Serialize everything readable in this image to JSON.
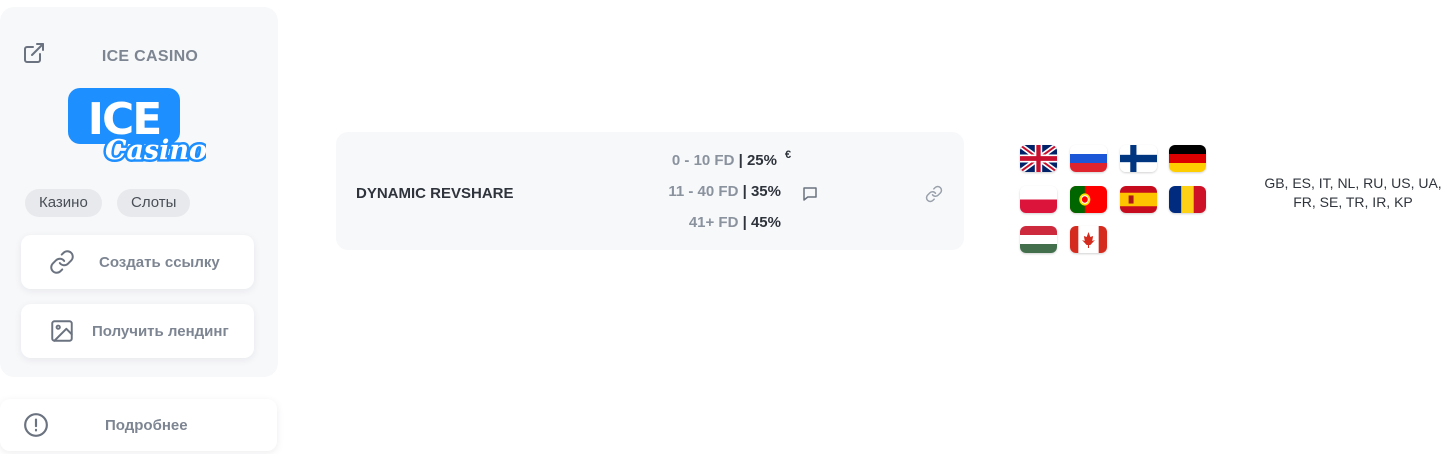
{
  "casino": {
    "name": "ICE CASINO",
    "logo_text": {
      "top": "ICE",
      "bottom": "Casino"
    },
    "tags": [
      "Казино",
      "Слоты"
    ],
    "create_link_label": "Создать ссылку",
    "get_landing_label": "Получить лендинг",
    "more_label": "Подробнее"
  },
  "deal": {
    "name": "DYNAMIC REVSHARE",
    "currency_symbol": "€",
    "tiers": [
      {
        "range": "0 - 10 FD",
        "sep": " | ",
        "percent": "25%"
      },
      {
        "range": "11 - 40 FD",
        "sep": " | ",
        "percent": "35%"
      },
      {
        "range": "41+ FD",
        "sep": " | ",
        "percent": "45%"
      }
    ]
  },
  "geo": {
    "flags": [
      "gb-flag-icon",
      "ru-flag-icon",
      "fi-flag-icon",
      "de-flag-icon",
      "pl-flag-icon",
      "pt-flag-icon",
      "es-flag-icon",
      "ro-flag-icon",
      "hu-flag-icon",
      "ca-flag-icon"
    ],
    "countries_line1": "GB, ES, IT, NL, RU, US, UA,",
    "countries_line2": "FR, SE, TR, IR, KP"
  },
  "colors": {
    "card_bg": "#f7f8fa",
    "muted_text": "#7d8592",
    "dark_text": "#2f343c",
    "tag_bg": "#e7e9ec",
    "logo_blue": "#1e8fff"
  }
}
